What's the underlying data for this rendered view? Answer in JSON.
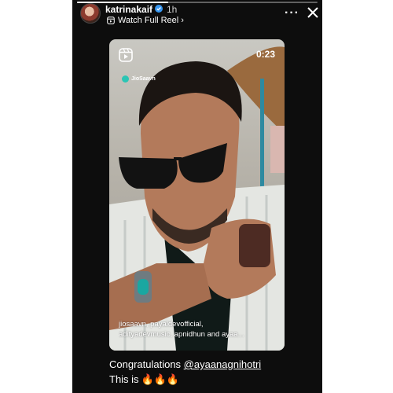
{
  "story": {
    "progress": 0.38,
    "username": "katrinakaif",
    "time": "1h",
    "watch_label": "Watch Full Reel",
    "watch_chevron": "›",
    "more_label": "···",
    "icons": [
      "verified-icon",
      "reel-icon",
      "more-icon",
      "close-icon",
      "chevron-right-icon"
    ]
  },
  "reel": {
    "duration": "0:23",
    "brand": "JioSaavn",
    "credits_line1": "jiosaavn, payaldevofficial,",
    "credits_line2": "adityadevmusic, apnidhun and ayaa..."
  },
  "caption": {
    "prefix": "Congratulations ",
    "mention": "@ayaanagnihotri",
    "line2": "This is",
    "emojis": "🔥🔥🔥"
  },
  "colors": {
    "story_background": "#0d0d0d",
    "text": "#ffffff",
    "brand_dot": "#2bc5b4",
    "verified": "#3897f0"
  }
}
